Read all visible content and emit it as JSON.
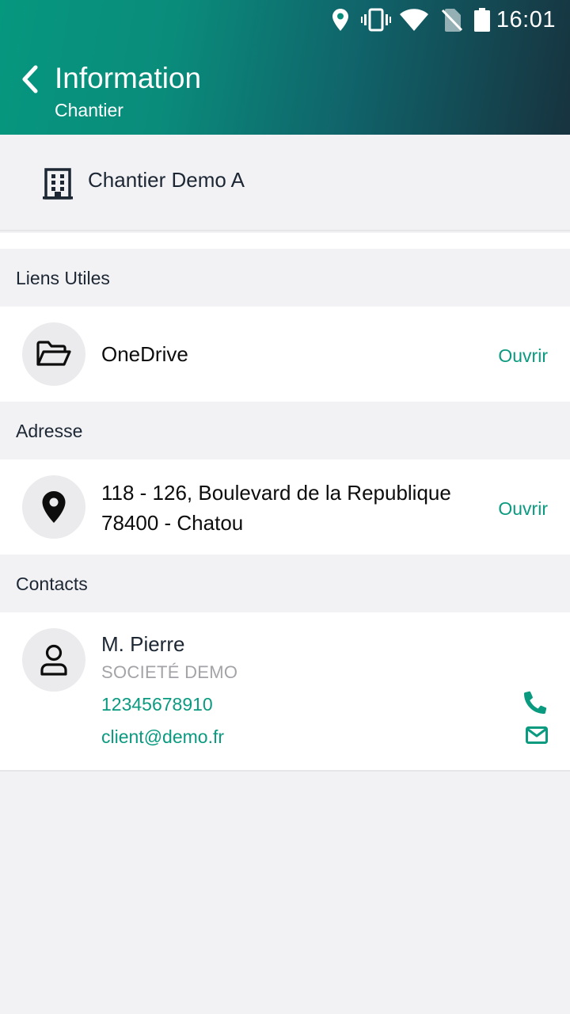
{
  "status_bar": {
    "time": "16:01",
    "icons": [
      "location-icon",
      "vibrate-icon",
      "wifi-icon",
      "no-sim-icon",
      "battery-icon"
    ]
  },
  "header": {
    "title": "Information",
    "subtitle": "Chantier"
  },
  "site": {
    "name": "Chantier Demo A",
    "icon": "building-icon"
  },
  "sections": {
    "links": {
      "title": "Liens Utiles",
      "items": [
        {
          "label": "OneDrive",
          "action": "Ouvrir",
          "icon": "folder-open-icon"
        }
      ]
    },
    "address": {
      "title": "Adresse",
      "line1": "118 - 126, Boulevard de la Republique",
      "line2": "78400 - Chatou",
      "action": "Ouvrir",
      "icon": "map-pin-icon"
    },
    "contacts": {
      "title": "Contacts",
      "items": [
        {
          "name": "M. Pierre",
          "company": "SOCIETÉ DEMO",
          "phone": "12345678910",
          "email": "client@demo.fr",
          "icon": "user-icon"
        }
      ]
    }
  },
  "colors": {
    "accent": "#0a9a80",
    "header_start": "#06977f",
    "header_end": "#17333f",
    "background": "#f2f2f4"
  }
}
